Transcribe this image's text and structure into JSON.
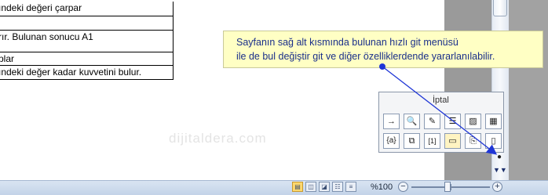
{
  "document": {
    "table_rows": [
      "ındeki değeri çarpar",
      "",
      "rır. Bulunan sonucu A1",
      "",
      "plar",
      "ındeki değer kadar kuvvetini bulur."
    ]
  },
  "watermark": "dijitaldera.com",
  "tooltip": {
    "line1": "Sayfanın sağ alt kısmında bulunan hızlı git menüsü",
    "line2": "ile de bul değiştir git ve diğer özelliklerdende yararlanılabilir."
  },
  "goto_panel": {
    "cancel_label": "İptal",
    "row1": [
      {
        "icon": "go-to-arrow-icon",
        "glyph": "→"
      },
      {
        "icon": "find-binoculars-icon",
        "glyph": "🔍"
      },
      {
        "icon": "edits-pencil-icon",
        "glyph": "✎"
      },
      {
        "icon": "headings-list-icon",
        "glyph": "☰"
      },
      {
        "icon": "graphic-image-icon",
        "glyph": "▨"
      },
      {
        "icon": "table-icon",
        "glyph": "▦"
      }
    ],
    "row2": [
      {
        "icon": "field-icon",
        "glyph": "{a}"
      },
      {
        "icon": "endnote-icon",
        "glyph": "⧉"
      },
      {
        "icon": "footnote-icon",
        "glyph": "[1]"
      },
      {
        "icon": "comment-icon",
        "glyph": "▭"
      },
      {
        "icon": "section-icon",
        "glyph": "⎘"
      },
      {
        "icon": "page-icon",
        "glyph": "▯"
      }
    ]
  },
  "browse": {
    "select_glyph": "●",
    "next_glyph": "▼▼"
  },
  "statusbar": {
    "zoom_level": "%100",
    "zoom_out_glyph": "−",
    "zoom_in_glyph": "+",
    "zoom_percent": 100
  },
  "colors": {
    "tooltip_bg": "#ffffc4",
    "tooltip_text": "#1a2f8a",
    "arrow": "#1f36d6"
  }
}
